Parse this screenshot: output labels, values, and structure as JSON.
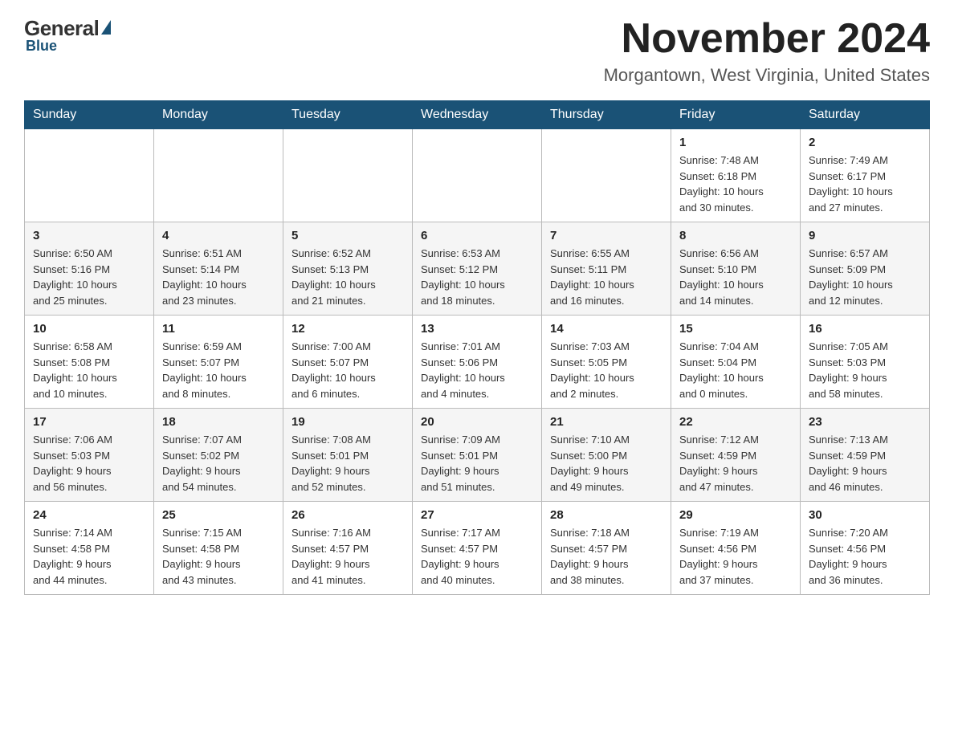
{
  "logo": {
    "general": "General",
    "blue": "Blue"
  },
  "header": {
    "month": "November 2024",
    "location": "Morgantown, West Virginia, United States"
  },
  "weekdays": [
    "Sunday",
    "Monday",
    "Tuesday",
    "Wednesday",
    "Thursday",
    "Friday",
    "Saturday"
  ],
  "weeks": [
    [
      {
        "day": "",
        "info": ""
      },
      {
        "day": "",
        "info": ""
      },
      {
        "day": "",
        "info": ""
      },
      {
        "day": "",
        "info": ""
      },
      {
        "day": "",
        "info": ""
      },
      {
        "day": "1",
        "info": "Sunrise: 7:48 AM\nSunset: 6:18 PM\nDaylight: 10 hours\nand 30 minutes."
      },
      {
        "day": "2",
        "info": "Sunrise: 7:49 AM\nSunset: 6:17 PM\nDaylight: 10 hours\nand 27 minutes."
      }
    ],
    [
      {
        "day": "3",
        "info": "Sunrise: 6:50 AM\nSunset: 5:16 PM\nDaylight: 10 hours\nand 25 minutes."
      },
      {
        "day": "4",
        "info": "Sunrise: 6:51 AM\nSunset: 5:14 PM\nDaylight: 10 hours\nand 23 minutes."
      },
      {
        "day": "5",
        "info": "Sunrise: 6:52 AM\nSunset: 5:13 PM\nDaylight: 10 hours\nand 21 minutes."
      },
      {
        "day": "6",
        "info": "Sunrise: 6:53 AM\nSunset: 5:12 PM\nDaylight: 10 hours\nand 18 minutes."
      },
      {
        "day": "7",
        "info": "Sunrise: 6:55 AM\nSunset: 5:11 PM\nDaylight: 10 hours\nand 16 minutes."
      },
      {
        "day": "8",
        "info": "Sunrise: 6:56 AM\nSunset: 5:10 PM\nDaylight: 10 hours\nand 14 minutes."
      },
      {
        "day": "9",
        "info": "Sunrise: 6:57 AM\nSunset: 5:09 PM\nDaylight: 10 hours\nand 12 minutes."
      }
    ],
    [
      {
        "day": "10",
        "info": "Sunrise: 6:58 AM\nSunset: 5:08 PM\nDaylight: 10 hours\nand 10 minutes."
      },
      {
        "day": "11",
        "info": "Sunrise: 6:59 AM\nSunset: 5:07 PM\nDaylight: 10 hours\nand 8 minutes."
      },
      {
        "day": "12",
        "info": "Sunrise: 7:00 AM\nSunset: 5:07 PM\nDaylight: 10 hours\nand 6 minutes."
      },
      {
        "day": "13",
        "info": "Sunrise: 7:01 AM\nSunset: 5:06 PM\nDaylight: 10 hours\nand 4 minutes."
      },
      {
        "day": "14",
        "info": "Sunrise: 7:03 AM\nSunset: 5:05 PM\nDaylight: 10 hours\nand 2 minutes."
      },
      {
        "day": "15",
        "info": "Sunrise: 7:04 AM\nSunset: 5:04 PM\nDaylight: 10 hours\nand 0 minutes."
      },
      {
        "day": "16",
        "info": "Sunrise: 7:05 AM\nSunset: 5:03 PM\nDaylight: 9 hours\nand 58 minutes."
      }
    ],
    [
      {
        "day": "17",
        "info": "Sunrise: 7:06 AM\nSunset: 5:03 PM\nDaylight: 9 hours\nand 56 minutes."
      },
      {
        "day": "18",
        "info": "Sunrise: 7:07 AM\nSunset: 5:02 PM\nDaylight: 9 hours\nand 54 minutes."
      },
      {
        "day": "19",
        "info": "Sunrise: 7:08 AM\nSunset: 5:01 PM\nDaylight: 9 hours\nand 52 minutes."
      },
      {
        "day": "20",
        "info": "Sunrise: 7:09 AM\nSunset: 5:01 PM\nDaylight: 9 hours\nand 51 minutes."
      },
      {
        "day": "21",
        "info": "Sunrise: 7:10 AM\nSunset: 5:00 PM\nDaylight: 9 hours\nand 49 minutes."
      },
      {
        "day": "22",
        "info": "Sunrise: 7:12 AM\nSunset: 4:59 PM\nDaylight: 9 hours\nand 47 minutes."
      },
      {
        "day": "23",
        "info": "Sunrise: 7:13 AM\nSunset: 4:59 PM\nDaylight: 9 hours\nand 46 minutes."
      }
    ],
    [
      {
        "day": "24",
        "info": "Sunrise: 7:14 AM\nSunset: 4:58 PM\nDaylight: 9 hours\nand 44 minutes."
      },
      {
        "day": "25",
        "info": "Sunrise: 7:15 AM\nSunset: 4:58 PM\nDaylight: 9 hours\nand 43 minutes."
      },
      {
        "day": "26",
        "info": "Sunrise: 7:16 AM\nSunset: 4:57 PM\nDaylight: 9 hours\nand 41 minutes."
      },
      {
        "day": "27",
        "info": "Sunrise: 7:17 AM\nSunset: 4:57 PM\nDaylight: 9 hours\nand 40 minutes."
      },
      {
        "day": "28",
        "info": "Sunrise: 7:18 AM\nSunset: 4:57 PM\nDaylight: 9 hours\nand 38 minutes."
      },
      {
        "day": "29",
        "info": "Sunrise: 7:19 AM\nSunset: 4:56 PM\nDaylight: 9 hours\nand 37 minutes."
      },
      {
        "day": "30",
        "info": "Sunrise: 7:20 AM\nSunset: 4:56 PM\nDaylight: 9 hours\nand 36 minutes."
      }
    ]
  ]
}
